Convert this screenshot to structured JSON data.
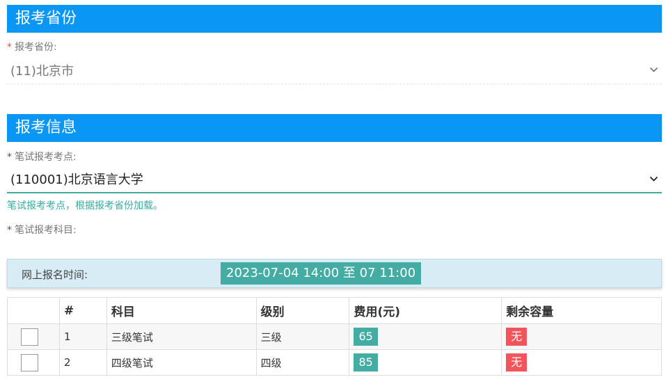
{
  "province_section": {
    "title": "报考省份",
    "label": "报考省份:",
    "required_mark": "*",
    "selected": "(11)北京市"
  },
  "info_section": {
    "title": "报考信息",
    "exam_site_label": "笔试报考考点:",
    "exam_site_required_mark": "*",
    "exam_site_selected": "(110001)北京语言大学",
    "exam_site_hint": "笔试报考考点，根据报考省份加载。",
    "subject_label": "笔试报考科目:",
    "subject_required_mark": "*"
  },
  "registration_time": {
    "label": "网上报名时间:",
    "value": "2023-07-04 14:00 至 07 11:00"
  },
  "subjects_table": {
    "columns": [
      "",
      "#",
      "科目",
      "级别",
      "费用(元)",
      "剩余容量"
    ],
    "rows": [
      {
        "index": "1",
        "subject": "三级笔试",
        "level": "三级",
        "fee": "65",
        "capacity": "无"
      },
      {
        "index": "2",
        "subject": "四级笔试",
        "level": "四级",
        "fee": "85",
        "capacity": "无"
      }
    ]
  },
  "colors": {
    "header_blue": "#0a96f5",
    "teal": "#45aca3",
    "badge_red": "#f2545b",
    "info_box_bg": "#d7ecf5"
  },
  "icons": {
    "dropdown": "chevron-down-icon"
  }
}
